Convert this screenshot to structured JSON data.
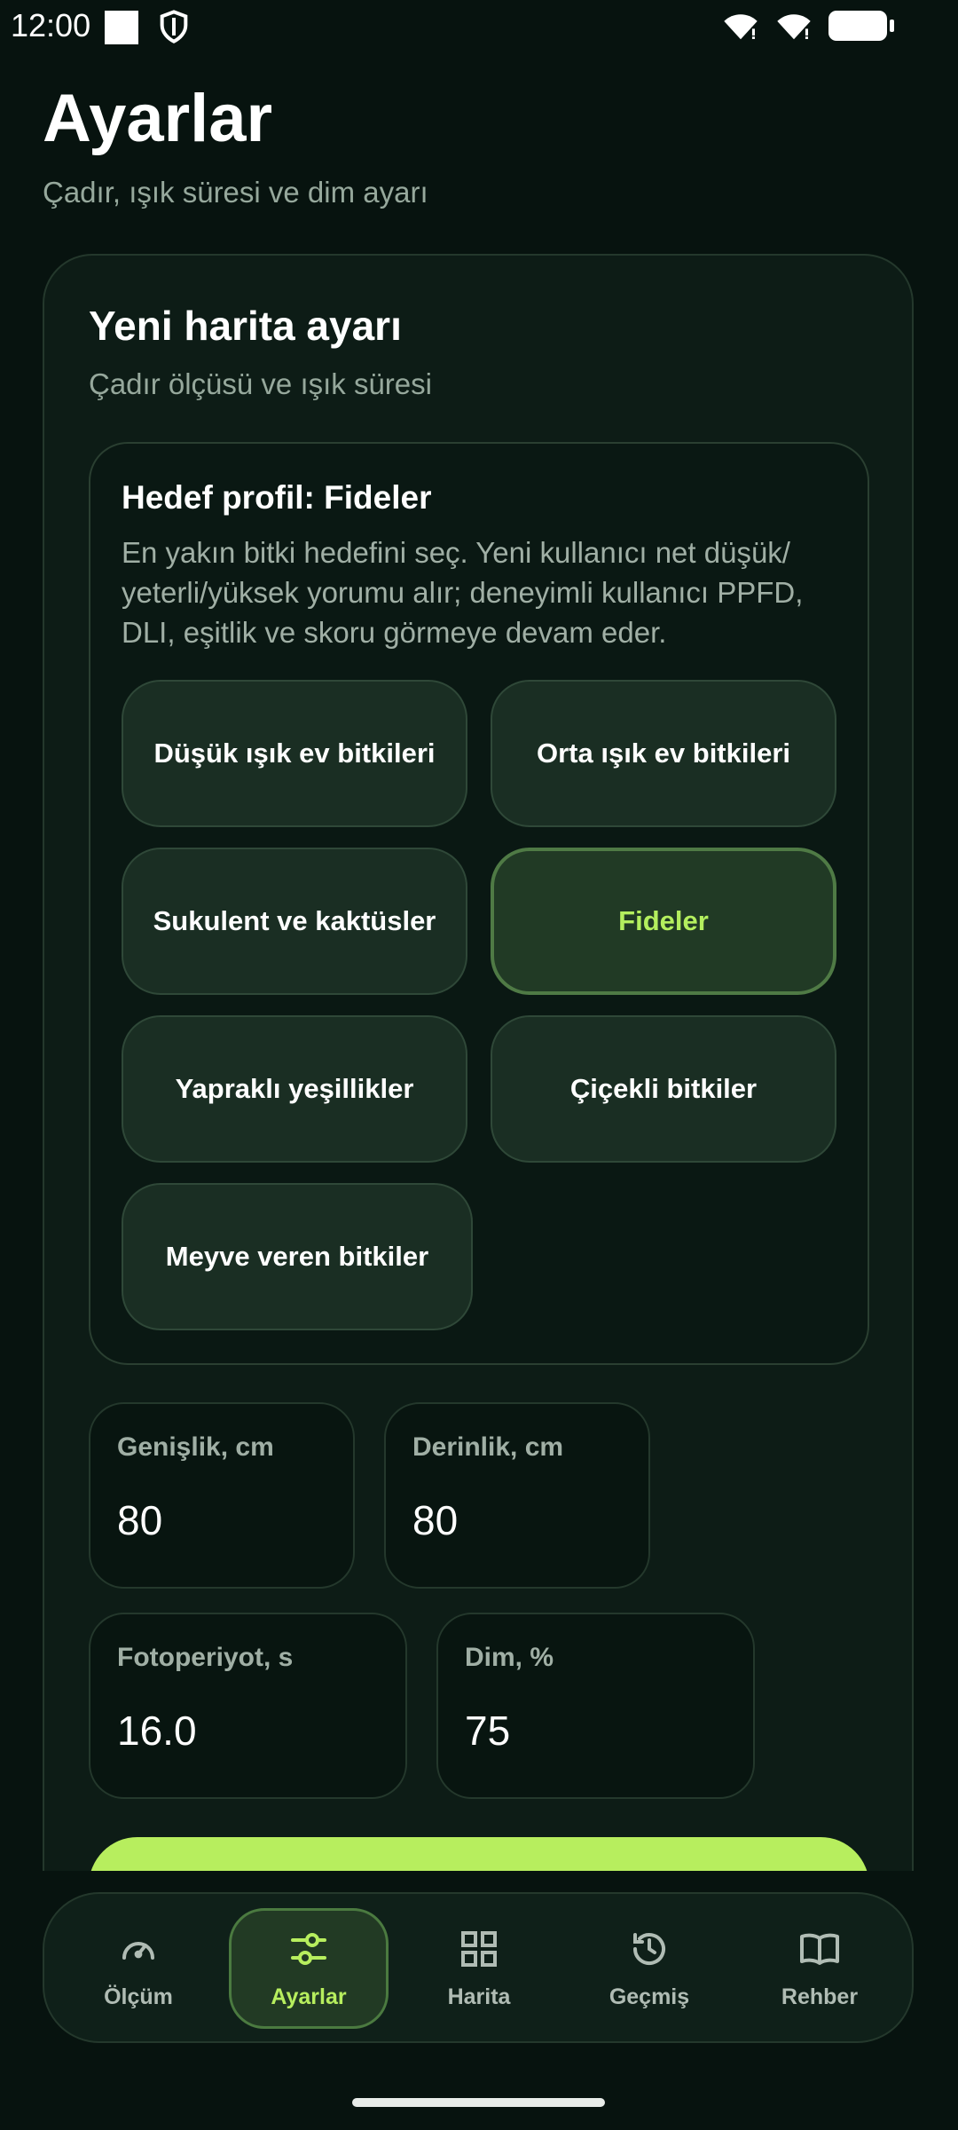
{
  "status": {
    "time": "12:00"
  },
  "page": {
    "title": "Ayarlar",
    "subtitle": "Çadır, ışık süresi ve dim ayarı"
  },
  "card": {
    "title": "Yeni harita ayarı",
    "subtitle": "Çadır ölçüsü ve ışık süresi",
    "profile": {
      "title": "Hedef profil: Fideler",
      "description": "En yakın bitki hedefini seç. Yeni kullanıcı net düşük/ yeterli/yüksek yorumu alır; deneyimli kullanıcı PPFD, DLI, eşitlik ve skoru görmeye devam eder.",
      "options": [
        "Düşük ışık ev bitkileri",
        "Orta ışık ev bitkileri",
        "Sukulent ve kaktüsler",
        "Fideler",
        "Yapraklı yeşillikler",
        "Çiçekli bitkiler",
        "Meyve veren bitkiler"
      ],
      "selected": "Fideler"
    },
    "fields": {
      "width": {
        "label": "Genişlik, cm",
        "value": "80"
      },
      "depth": {
        "label": "Derinlik, cm",
        "value": "80"
      },
      "photoperiod": {
        "label": "Fotoperiyot, s",
        "value": "16.0"
      },
      "dim": {
        "label": "Dim, %",
        "value": "75"
      }
    }
  },
  "nav": {
    "items": [
      {
        "label": "Ölçüm",
        "icon": "gauge-icon"
      },
      {
        "label": "Ayarlar",
        "icon": "sliders-icon"
      },
      {
        "label": "Harita",
        "icon": "grid-icon"
      },
      {
        "label": "Geçmiş",
        "icon": "history-icon"
      },
      {
        "label": "Rehber",
        "icon": "book-icon"
      }
    ],
    "active": "Ayarlar"
  },
  "colors": {
    "background": "#07130f",
    "accent": "#b7ee5e",
    "card": "#0d1c16",
    "chip": "#1a2e23"
  }
}
